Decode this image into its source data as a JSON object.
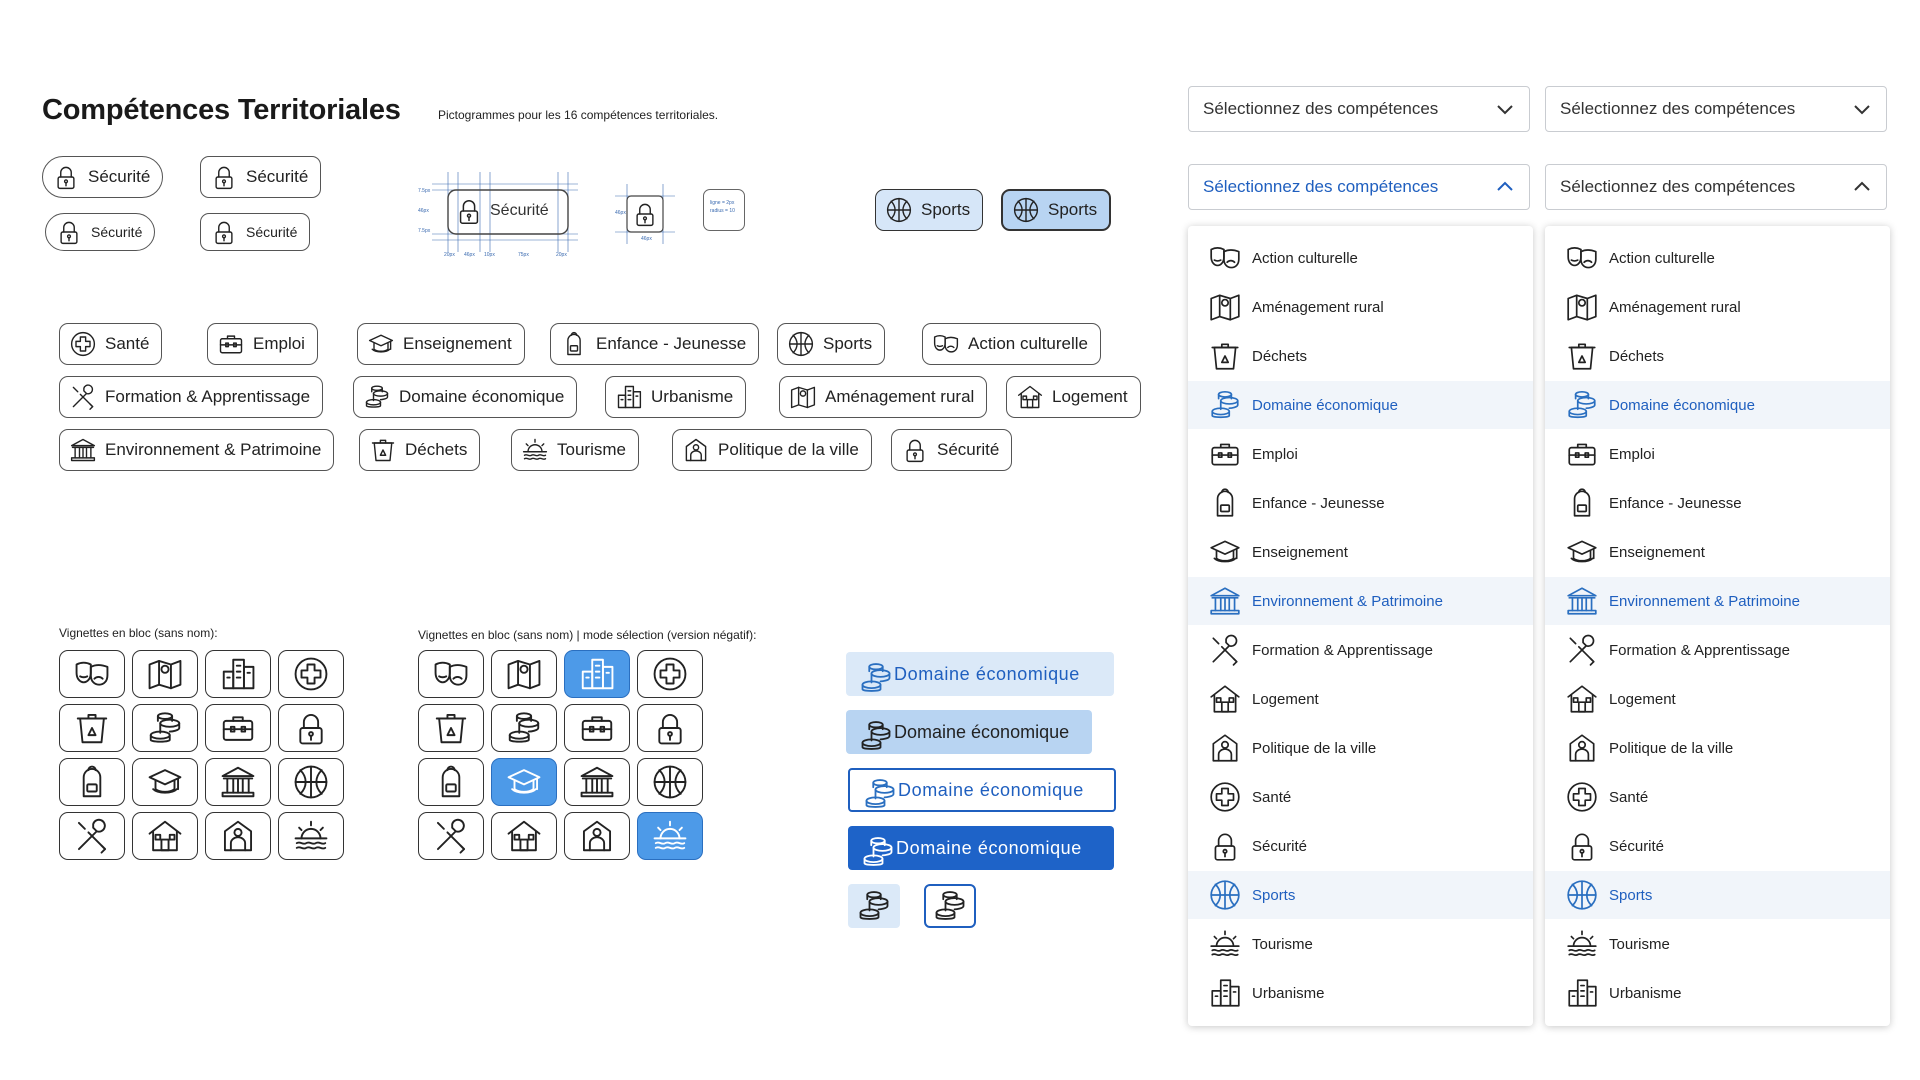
{
  "header": {
    "title": "Compétences Territoriales",
    "subtitle": "Pictogrammes pour les 16 compétences territoriales."
  },
  "variants": {
    "securite": "Sécurité",
    "sports": "Sports"
  },
  "spec": {
    "label": "Sécurité",
    "notes": [
      "7.5px",
      "46px",
      "7.5px",
      "20px",
      "46px",
      "10px",
      "75px",
      "20px",
      "46px",
      "46px",
      "ligne = 2px",
      "radius = 10"
    ]
  },
  "chips": [
    {
      "label": "Santé",
      "icon": "plus"
    },
    {
      "label": "Emploi",
      "icon": "briefcase"
    },
    {
      "label": "Enseignement",
      "icon": "cap"
    },
    {
      "label": "Enfance - Jeunesse",
      "icon": "backpack"
    },
    {
      "label": "Sports",
      "icon": "ball"
    },
    {
      "label": "Action culturelle",
      "icon": "masks"
    },
    {
      "label": "Formation & Apprentissage",
      "icon": "tools"
    },
    {
      "label": "Domaine économique",
      "icon": "coins"
    },
    {
      "label": "Urbanisme",
      "icon": "city"
    },
    {
      "label": "Aménagement rural",
      "icon": "map"
    },
    {
      "label": "Logement",
      "icon": "house"
    },
    {
      "label": "Environnement & Patrimoine",
      "icon": "temple"
    },
    {
      "label": "Déchets",
      "icon": "bin"
    },
    {
      "label": "Tourisme",
      "icon": "sun"
    },
    {
      "label": "Politique de la ville",
      "icon": "person"
    },
    {
      "label": "Sécurité",
      "icon": "lock"
    }
  ],
  "blocks": {
    "caption1": "Vignettes en bloc (sans nom):",
    "caption2": "Vignettes en bloc (sans nom) | mode sélection (version négatif):"
  },
  "tiles": [
    "masks",
    "map",
    "city",
    "plus",
    "bin",
    "coins",
    "briefcase",
    "lock",
    "backpack",
    "cap",
    "temple",
    "ball",
    "tools",
    "house",
    "person",
    "sun"
  ],
  "selected_tiles": [
    2,
    9,
    15
  ],
  "domaine": {
    "label": "Domaine économique"
  },
  "dropdown": {
    "placeholder": "Sélectionnez des compétences"
  },
  "options": [
    {
      "label": "Action culturelle",
      "icon": "masks",
      "hl": false
    },
    {
      "label": "Aménagement rural",
      "icon": "map",
      "hl": false
    },
    {
      "label": "Déchets",
      "icon": "bin",
      "hl": false
    },
    {
      "label": "Domaine économique",
      "icon": "coins",
      "hl": true
    },
    {
      "label": "Emploi",
      "icon": "briefcase",
      "hl": false
    },
    {
      "label": "Enfance - Jeunesse",
      "icon": "backpack",
      "hl": false
    },
    {
      "label": "Enseignement",
      "icon": "cap",
      "hl": false
    },
    {
      "label": "Environnement & Patrimoine",
      "icon": "temple",
      "hl": true
    },
    {
      "label": "Formation & Apprentissage",
      "icon": "tools",
      "hl": false
    },
    {
      "label": "Logement",
      "icon": "house",
      "hl": false
    },
    {
      "label": "Politique de la ville",
      "icon": "person",
      "hl": false
    },
    {
      "label": "Santé",
      "icon": "plus",
      "hl": false
    },
    {
      "label": "Sécurité",
      "icon": "lock",
      "hl": false
    },
    {
      "label": "Sports",
      "icon": "ball",
      "hl": true
    },
    {
      "label": "Tourisme",
      "icon": "sun",
      "hl": false
    },
    {
      "label": "Urbanisme",
      "icon": "city",
      "hl": false
    }
  ],
  "colors": {
    "accent": "#1f5fbf",
    "selected_tile": "#4d9ae8",
    "highlight_row": "#f1f5fa",
    "chip_blue": "#d6e6f8"
  }
}
